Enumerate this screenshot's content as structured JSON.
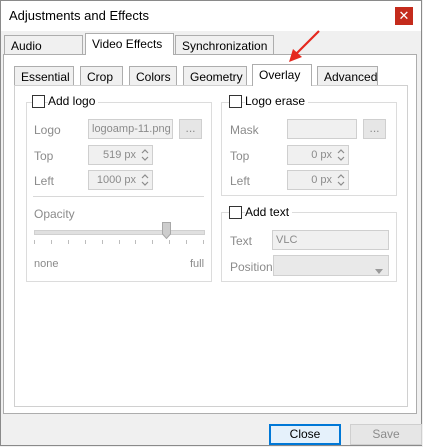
{
  "window": {
    "title": "Adjustments and Effects",
    "close_glyph": "✕"
  },
  "tabs": [
    "Audio Effects",
    "Video Effects",
    "Synchronization"
  ],
  "subtabs": [
    "Essential",
    "Crop",
    "Colors",
    "Geometry",
    "Overlay",
    "Advanced"
  ],
  "add_logo": {
    "checkbox_label": "Add logo",
    "logo_label": "Logo",
    "logo_value": "logoamp-11.png",
    "browse": "...",
    "top_label": "Top",
    "top_value": "519 px",
    "left_label": "Left",
    "left_value": "1000 px",
    "opacity_label": "Opacity",
    "opacity_min": "none",
    "opacity_max": "full",
    "opacity_level": 0.78
  },
  "logo_erase": {
    "checkbox_label": "Logo erase",
    "mask_label": "Mask",
    "mask_value": "",
    "browse": "...",
    "top_label": "Top",
    "top_value": "0 px",
    "left_label": "Left",
    "left_value": "0 px"
  },
  "add_text": {
    "checkbox_label": "Add text",
    "text_label": "Text",
    "text_value": "VLC",
    "position_label": "Position",
    "position_value": ""
  },
  "buttons": {
    "close": "Close",
    "save": "Save"
  },
  "annotation": {
    "color": "#e5281e",
    "target": "Overlay tab"
  }
}
